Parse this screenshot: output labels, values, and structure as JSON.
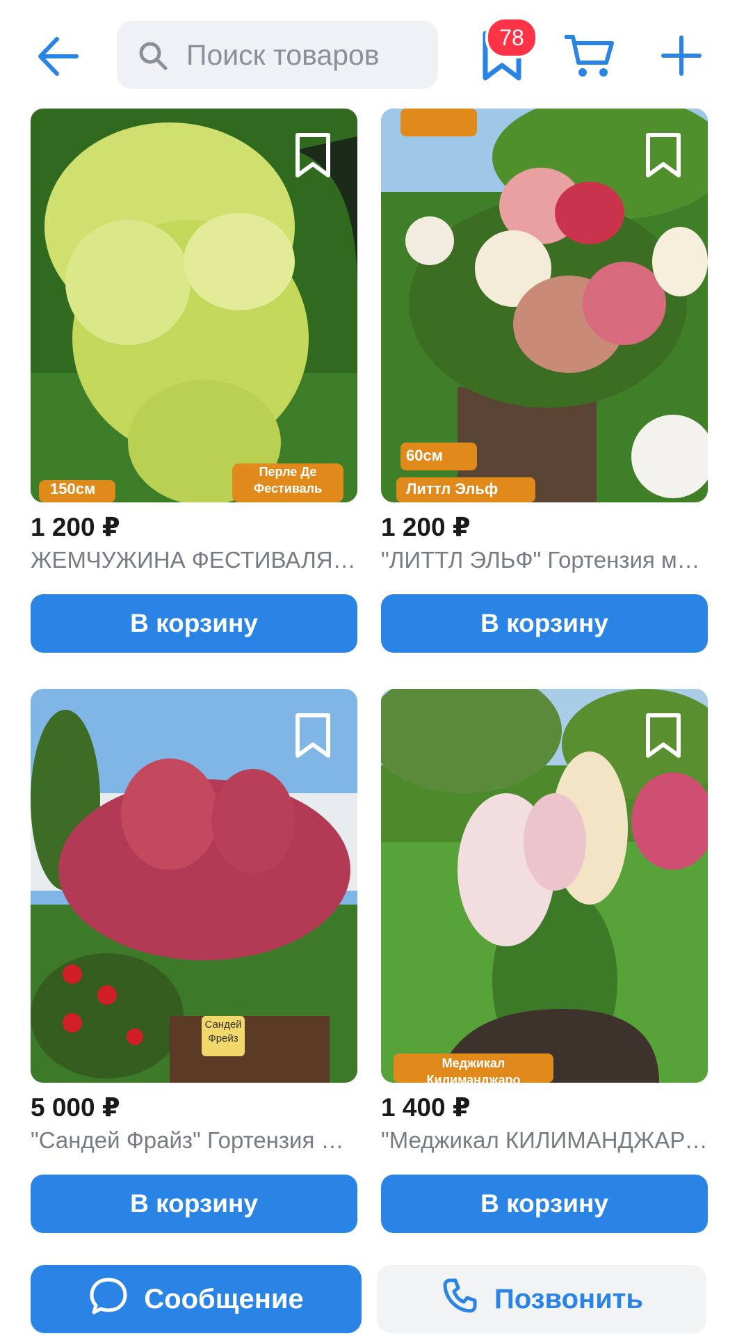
{
  "header": {
    "search_placeholder": "Поиск товаров",
    "bookmarks_count": "78",
    "icons": {
      "back": "back-arrow-icon",
      "search": "search-icon",
      "bookmark": "bookmark-icon",
      "cart": "cart-icon",
      "add": "plus-icon"
    }
  },
  "products": [
    {
      "price": "1 200 ₽",
      "title": "ЖЕМЧУЖИНА ФЕСТИВАЛЯ Гортензия метельчатая",
      "button": "В корзину",
      "photo_tags": {
        "height": "150см",
        "name_line1": "Перле Де",
        "name_line2": "Фестиваль"
      }
    },
    {
      "price": "1 200 ₽",
      "title": "\"ЛИТТЛ ЭЛЬФ\" Гортензия метельчатая",
      "button": "В корзину",
      "photo_tags": {
        "height": "60см",
        "name": "Литтл Эльф"
      }
    },
    {
      "price": "5 000 ₽",
      "title": "\"Сандей Фрайз\" Гортензия метельчатая",
      "button": "В корзину",
      "photo_tags": {
        "sign_line1": "Сандей",
        "sign_line2": "Фрейз"
      }
    },
    {
      "price": "1 400 ₽",
      "title": "\"Меджикал КИЛИМАНДЖАРО\" Гортензия метельчатая",
      "button": "В корзину",
      "photo_tags": {
        "name_line1": "Меджикал",
        "name_line2": "Килиманджаро"
      }
    }
  ],
  "actions": {
    "message": "Сообщение",
    "call": "Позвонить"
  },
  "colors": {
    "accent": "#2a84e6",
    "badge": "#ff3347",
    "muted_text": "#767b84"
  }
}
